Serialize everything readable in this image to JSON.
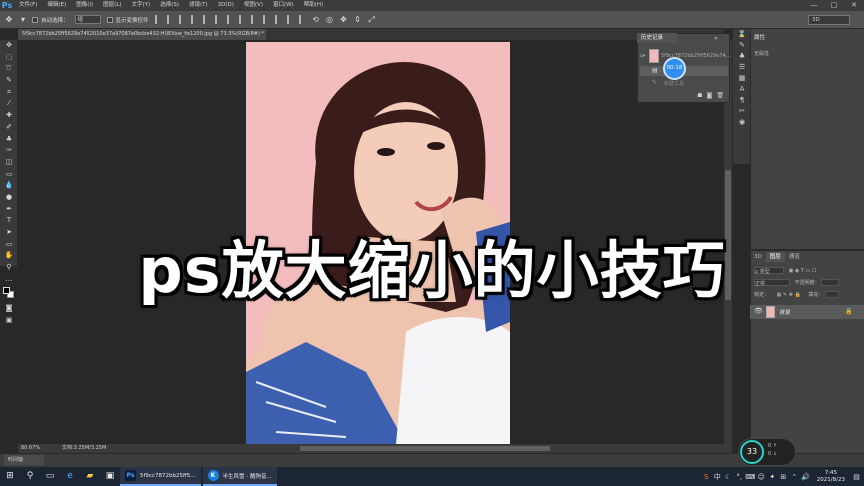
{
  "menubar": {
    "logo": "Ps",
    "items": [
      "文件(F)",
      "编辑(E)",
      "图像(I)",
      "图层(L)",
      "文字(Y)",
      "选择(S)",
      "滤镜(T)",
      "3D(D)",
      "视图(V)",
      "窗口(W)",
      "帮助(H)"
    ],
    "window_controls": [
      "—",
      "□",
      "✕"
    ]
  },
  "options": {
    "auto_select_label": "自动选择：",
    "auto_select_value": "组",
    "transform_label": "显示变换控件",
    "mode_3d": "3D"
  },
  "document": {
    "tab_title": "5f9cc7872bb25ff5629e7452010e37a97087e0bcbe432-HUEXxw_fw1200.jpg @ 73.3%(RGB/8#) *"
  },
  "status": {
    "zoom": "80.67%",
    "doc_size": "文档:3.25M/3.25M"
  },
  "timeline": {
    "label": "时间轴"
  },
  "history": {
    "tab": "历史记录",
    "snapshot_name": "5f9cc7872bb25ff5629e74...",
    "row2_text": "新建工具",
    "timer": "00:18"
  },
  "properties": {
    "tab": "属性",
    "empty_text": "无属性"
  },
  "layers": {
    "tabs": [
      "3D",
      "图层",
      "通道"
    ],
    "filter_label": "ρ 类型",
    "blend_mode": "正常",
    "opacity_label": "不透明度：",
    "lock_label": "锁定：",
    "fill_label": "填充：",
    "layer_name": "背景"
  },
  "caption": {
    "text": "ps放大缩小的小技巧"
  },
  "taskbar": {
    "apps": [
      {
        "label": "5f9cc7872bb25ff5...",
        "icon": "Ps"
      },
      {
        "label": "半生风雪 - 酷狗音...",
        "icon": "K"
      }
    ],
    "time": "7:45",
    "date": "2021/8/23",
    "ime": "中"
  },
  "net_widget": {
    "percent": "33",
    "up_rate": "0",
    "down_rate": "0"
  }
}
